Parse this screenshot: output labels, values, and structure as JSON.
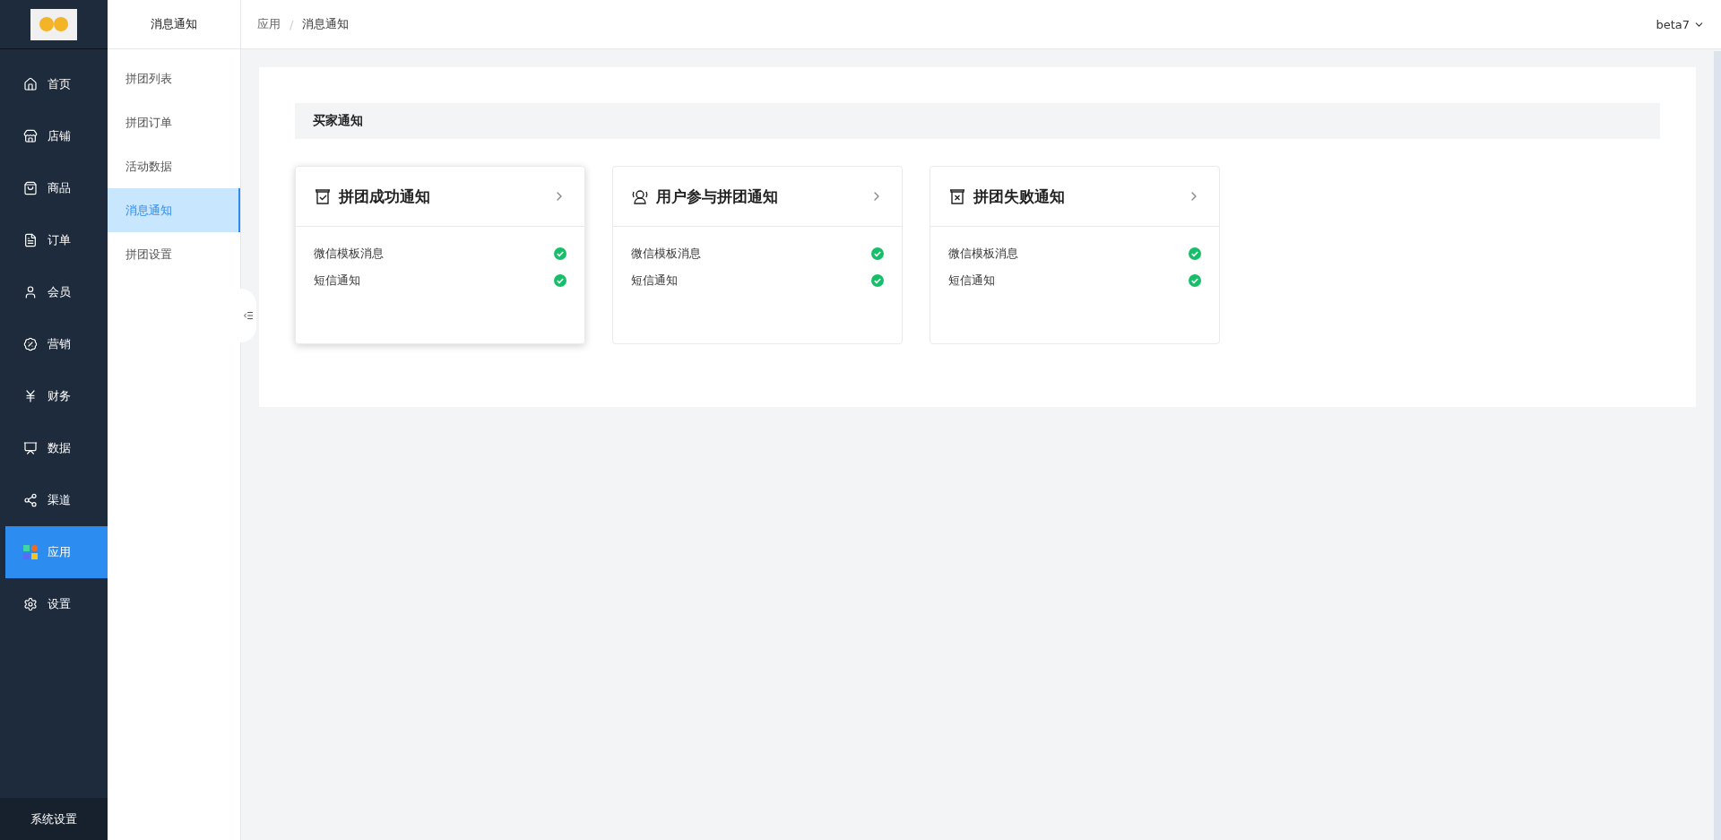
{
  "nav": {
    "items": [
      {
        "kind": "home",
        "label": "首页",
        "selected": false
      },
      {
        "kind": "store",
        "label": "店铺",
        "selected": false
      },
      {
        "kind": "bag",
        "label": "商品",
        "selected": false
      },
      {
        "kind": "order",
        "label": "订单",
        "selected": false
      },
      {
        "kind": "user",
        "label": "会员",
        "selected": false
      },
      {
        "kind": "marketing",
        "label": "营销",
        "selected": false
      },
      {
        "kind": "finance",
        "label": "财务",
        "selected": false
      },
      {
        "kind": "data",
        "label": "数据",
        "selected": false
      },
      {
        "kind": "channel",
        "label": "渠道",
        "selected": false
      },
      {
        "kind": "apps",
        "label": "应用",
        "selected": true
      },
      {
        "kind": "settings",
        "label": "设置",
        "selected": false
      }
    ],
    "footer": "系统设置"
  },
  "submenu": {
    "title": "消息通知",
    "items": [
      {
        "label": "拼团列表",
        "selected": false
      },
      {
        "label": "拼团订单",
        "selected": false
      },
      {
        "label": "活动数据",
        "selected": false
      },
      {
        "label": "消息通知",
        "selected": true
      },
      {
        "label": "拼团设置",
        "selected": false
      }
    ]
  },
  "breadcrumb": {
    "items": [
      "应用",
      "消息通知"
    ],
    "separator": "/"
  },
  "user_menu": "beta7",
  "section": {
    "title": "买家通知",
    "cards": [
      {
        "kind": "success",
        "title": "拼团成功通知",
        "hovered": true,
        "channels": [
          {
            "label": "微信模板消息",
            "enabled": true
          },
          {
            "label": "短信通知",
            "enabled": true
          }
        ]
      },
      {
        "kind": "join",
        "title": "用户参与拼团通知",
        "hovered": false,
        "channels": [
          {
            "label": "微信模板消息",
            "enabled": true
          },
          {
            "label": "短信通知",
            "enabled": true
          }
        ]
      },
      {
        "kind": "fail",
        "title": "拼团失败通知",
        "hovered": false,
        "channels": [
          {
            "label": "微信模板消息",
            "enabled": true
          },
          {
            "label": "短信通知",
            "enabled": true
          }
        ]
      }
    ]
  }
}
